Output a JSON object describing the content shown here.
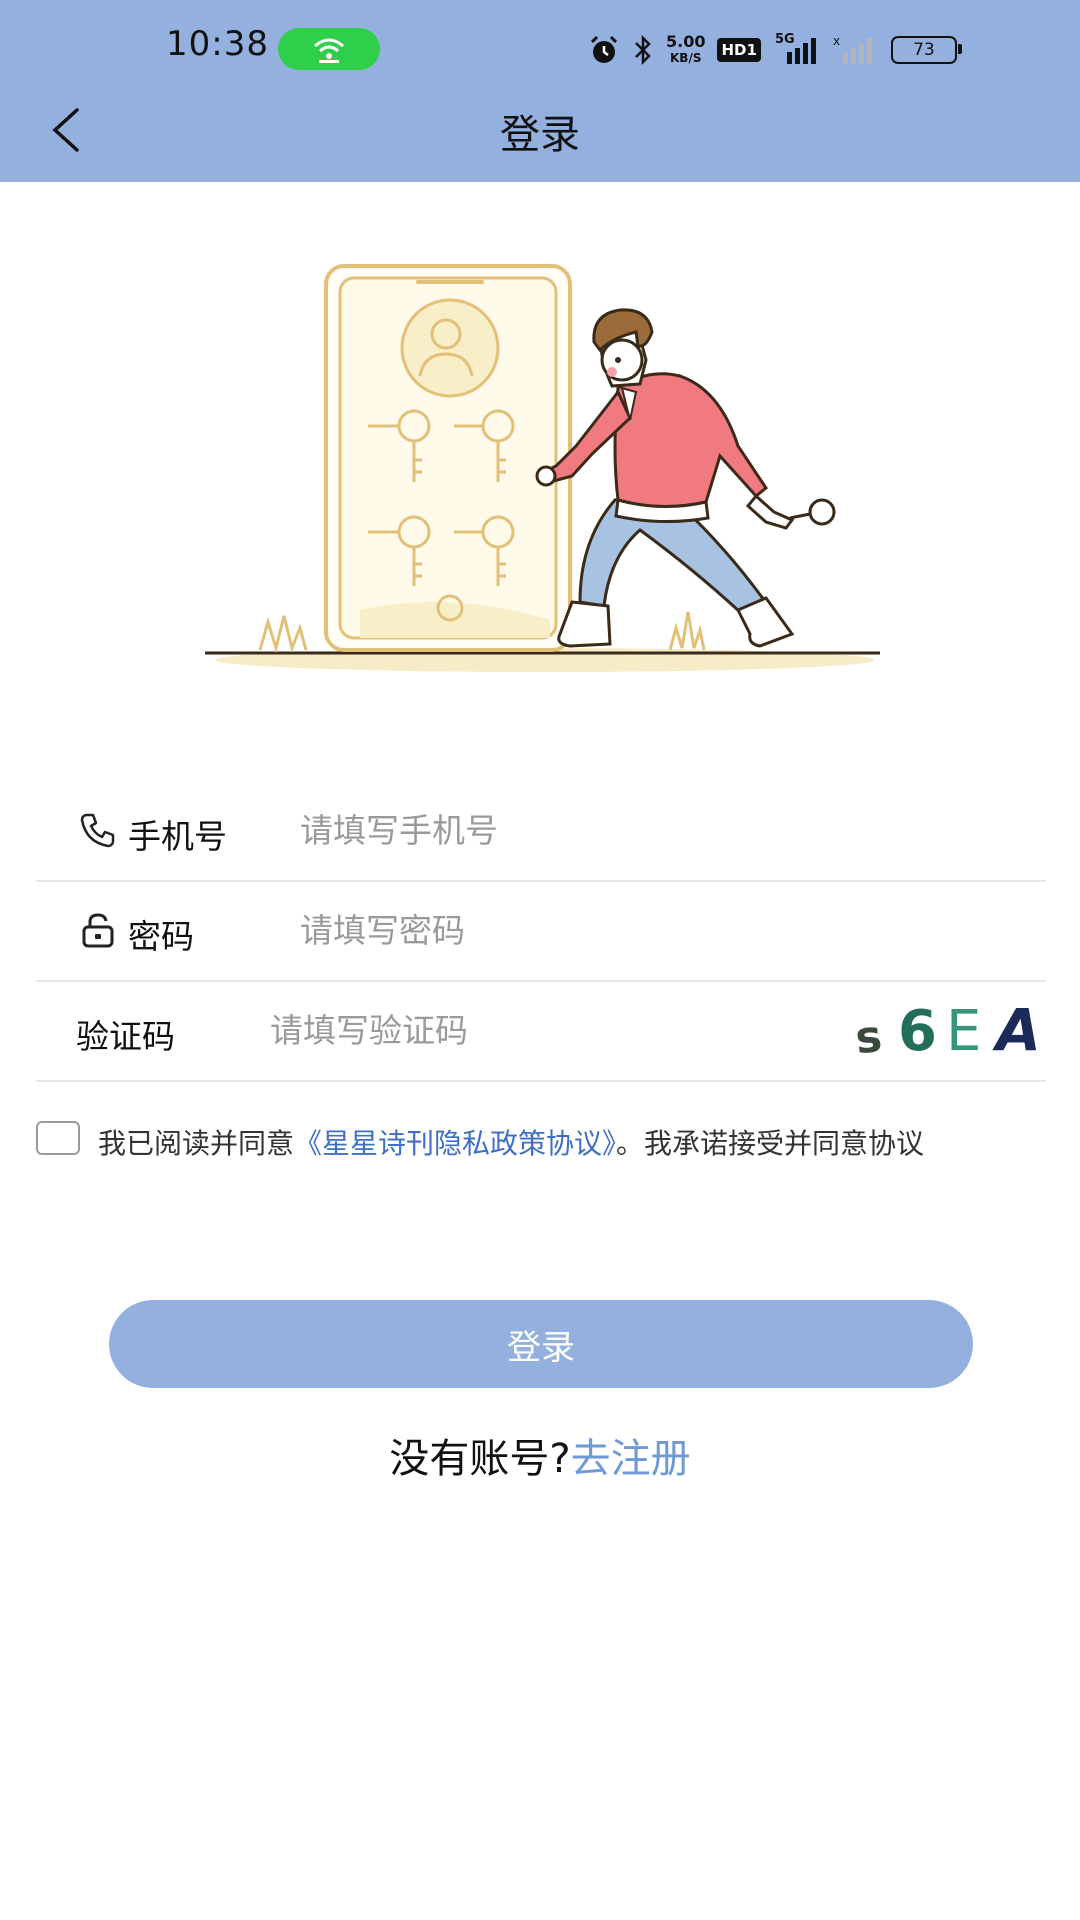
{
  "status_bar": {
    "time": "10:38",
    "net_speed_value": "5.00",
    "net_speed_unit": "KB/S",
    "hd_label": "HD1",
    "network_type": "5G",
    "battery_level": "73"
  },
  "header": {
    "title": "登录"
  },
  "form": {
    "phone_label": "手机号",
    "phone_placeholder": "请填写手机号",
    "password_label": "密码",
    "password_placeholder": "请填写密码",
    "captcha_label": "验证码",
    "captcha_placeholder": "请填写验证码",
    "captcha_chars": [
      "s",
      "6",
      "E",
      "A"
    ]
  },
  "agreement": {
    "checked": false,
    "prefix": "我已阅读并同意",
    "link": "《星星诗刊隐私政策协议》",
    "suffix": "。我承诺接受并同意协议"
  },
  "login_button": "登录",
  "register": {
    "prompt": "没有账号?",
    "link": "去注册"
  },
  "colors": {
    "header_bg": "#94b0df",
    "button_bg": "#94b0df",
    "link": "#3f6fc3",
    "register_link": "#6f98d6"
  }
}
